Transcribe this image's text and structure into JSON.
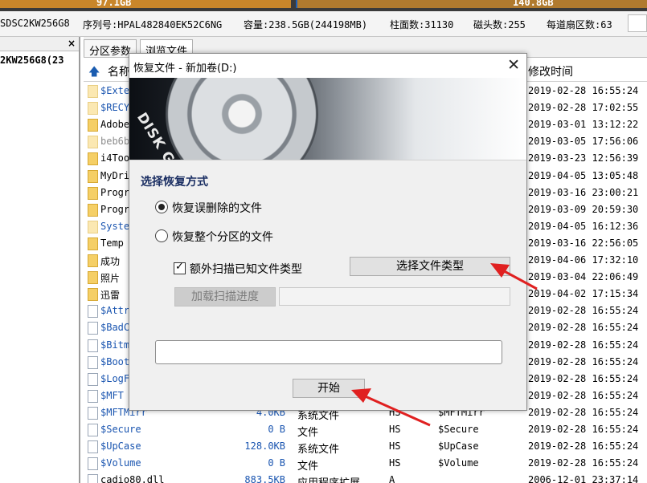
{
  "capacity": {
    "left_value": "97.1GB",
    "right_value": "140.8GB"
  },
  "disk_info": {
    "model": "SDSC2KW256G8",
    "serial": "序列号:HPAL482840EK52C6NG",
    "capacity": "容量:238.5GB(244198MB)",
    "cylinders": "柱面数:31130",
    "heads": "磁头数:255",
    "sectors": "每道扇区数:63"
  },
  "left_panel": {
    "close": "×",
    "node": "2KW256G8(23"
  },
  "tabs": [
    {
      "label": "分区参数"
    },
    {
      "label": "浏览文件"
    }
  ],
  "list_header": {
    "name": "名称",
    "mtime": "修改时间"
  },
  "files": [
    {
      "name": "$Exte",
      "icon": "folder-faded",
      "color": "blue",
      "size": "",
      "type": "",
      "attr": "",
      "short": "",
      "mtime": "2019-02-28 16:55:24"
    },
    {
      "name": "$RECY",
      "icon": "folder-faded",
      "color": "blue",
      "size": "",
      "type": "",
      "attr": "",
      "short": "",
      "mtime": "2019-02-28 17:02:55"
    },
    {
      "name": "Adobe",
      "icon": "folder",
      "color": "black",
      "size": "",
      "type": "",
      "attr": "",
      "short": "",
      "mtime": "2019-03-01 13:12:22"
    },
    {
      "name": "beb6b",
      "icon": "folder-faded",
      "color": "gray",
      "size": "",
      "type": "",
      "attr": "",
      "short": "",
      "mtime": "2019-03-05 17:56:06"
    },
    {
      "name": "i4Too",
      "icon": "folder",
      "color": "black",
      "size": "",
      "type": "",
      "attr": "",
      "short": "",
      "mtime": "2019-03-23 12:56:39"
    },
    {
      "name": "MyDri",
      "icon": "folder",
      "color": "black",
      "size": "",
      "type": "",
      "attr": "",
      "short": "",
      "mtime": "2019-04-05 13:05:48"
    },
    {
      "name": "Progr",
      "icon": "folder",
      "color": "black",
      "size": "",
      "type": "",
      "attr": "",
      "short": "",
      "mtime": "2019-03-16 23:00:21"
    },
    {
      "name": "Progr",
      "icon": "folder",
      "color": "black",
      "size": "",
      "type": "",
      "attr": "",
      "short": "",
      "mtime": "2019-03-09 20:59:30"
    },
    {
      "name": "Syste",
      "icon": "folder-faded",
      "color": "blue",
      "size": "",
      "type": "",
      "attr": "",
      "short": "",
      "mtime": "2019-04-05 16:12:36"
    },
    {
      "name": "Temp",
      "icon": "folder",
      "color": "black",
      "size": "",
      "type": "",
      "attr": "",
      "short": "",
      "mtime": "2019-03-16 22:56:05"
    },
    {
      "name": "成功",
      "icon": "folder",
      "color": "black",
      "size": "",
      "type": "",
      "attr": "",
      "short": "",
      "mtime": "2019-04-06 17:32:10"
    },
    {
      "name": "照片",
      "icon": "folder",
      "color": "black",
      "size": "",
      "type": "",
      "attr": "",
      "short": "",
      "mtime": "2019-03-04 22:06:49"
    },
    {
      "name": "迅雷",
      "icon": "folder",
      "color": "black",
      "size": "",
      "type": "",
      "attr": "",
      "short": "",
      "mtime": "2019-04-02 17:15:34"
    },
    {
      "name": "$Attr",
      "icon": "file",
      "color": "blue",
      "size": "",
      "type": "",
      "attr": "",
      "short": "",
      "mtime": "2019-02-28 16:55:24"
    },
    {
      "name": "$BadC",
      "icon": "file",
      "color": "blue",
      "size": "",
      "type": "",
      "attr": "",
      "short": "",
      "mtime": "2019-02-28 16:55:24"
    },
    {
      "name": "$Bitm",
      "icon": "file",
      "color": "blue",
      "size": "",
      "type": "",
      "attr": "",
      "short": "",
      "mtime": "2019-02-28 16:55:24"
    },
    {
      "name": "$Boot",
      "icon": "file",
      "color": "blue",
      "size": "",
      "type": "",
      "attr": "",
      "short": "",
      "mtime": "2019-02-28 16:55:24"
    },
    {
      "name": "$LogF",
      "icon": "file",
      "color": "blue",
      "size": "",
      "type": "",
      "attr": "",
      "short": "",
      "mtime": "2019-02-28 16:55:24"
    },
    {
      "name": "$MFT",
      "icon": "file",
      "color": "blue",
      "size": "",
      "type": "",
      "attr": "",
      "short": "",
      "mtime": "2019-02-28 16:55:24"
    },
    {
      "name": "$MFTMirr",
      "icon": "file",
      "color": "blue",
      "size": "4.0KB",
      "type": "系统文件",
      "attr": "HS",
      "short": "$MFTMirr",
      "mtime": "2019-02-28 16:55:24"
    },
    {
      "name": "$Secure",
      "icon": "file",
      "color": "blue",
      "size": "0 B",
      "type": "文件",
      "attr": "HS",
      "short": "$Secure",
      "mtime": "2019-02-28 16:55:24"
    },
    {
      "name": "$UpCase",
      "icon": "file",
      "color": "blue",
      "size": "128.0KB",
      "type": "系统文件",
      "attr": "HS",
      "short": "$UpCase",
      "mtime": "2019-02-28 16:55:24"
    },
    {
      "name": "$Volume",
      "icon": "file",
      "color": "blue",
      "size": "0 B",
      "type": "文件",
      "attr": "HS",
      "short": "$Volume",
      "mtime": "2019-02-28 16:55:24"
    },
    {
      "name": "cadio80.dll",
      "icon": "file",
      "color": "black",
      "size": "883.5KB",
      "type": "应用程序扩展",
      "attr": "A",
      "short": "",
      "mtime": "2006-12-01 23:37:14"
    }
  ],
  "dialog": {
    "title": "恢复文件 - 新加卷(D:)",
    "close": "✕",
    "brand": "DISK GENIUS",
    "section_title": "选择恢复方式",
    "option_deleted": "恢复误删除的文件",
    "option_partition": "恢复整个分区的文件",
    "extra_scan_label": "额外扫描已知文件类型",
    "choose_type_button": "选择文件类型",
    "load_progress_button": "加载扫描进度",
    "start_button": "开始"
  },
  "colors": {
    "arrow": "#e02020",
    "accent_blue": "#1a55b0",
    "section_title": "#1b2f63"
  }
}
